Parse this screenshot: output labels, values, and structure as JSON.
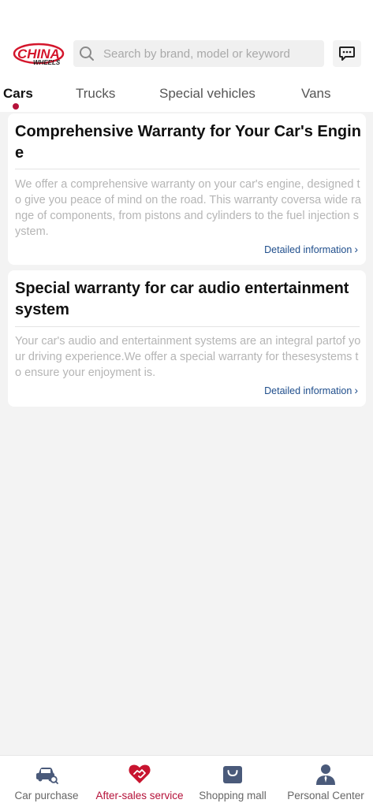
{
  "app": {
    "logo_text": "CHINA",
    "logo_subtext": "WHEELS",
    "brand_color": "#d4162c",
    "accent_color": "#b5123a",
    "link_color": "#1f4e8c"
  },
  "header": {
    "search_placeholder": "Search by brand, model or keyword",
    "search_icon": "search-icon",
    "message_icon": "chat-bubble-icon"
  },
  "tabs": [
    {
      "label": "Cars",
      "active": true
    },
    {
      "label": "Trucks",
      "active": false
    },
    {
      "label": "Special vehicles",
      "active": false
    },
    {
      "label": "Vans",
      "active": false
    }
  ],
  "cards": [
    {
      "title": "Comprehensive Warranty for Your Car's Engine",
      "description": "We offer a comprehensive warranty on your car's engine, designed to give you peace of mind on the road. This warranty coversa wide range of components, from pistons and cylinders to the fuel injection system.",
      "link": "Detailed information"
    },
    {
      "title": "Special warranty for car audio entertainment system",
      "description": "Your car's audio and entertainment systems are an integral partof your driving experience.We offer a special warranty for thesesystems to ensure your enjoyment is.",
      "link": "Detailed information"
    }
  ],
  "bottom_nav": [
    {
      "label": "Car purchase",
      "icon": "car-search-icon",
      "active": false
    },
    {
      "label": "After-sales service",
      "icon": "handshake-heart-icon",
      "active": true
    },
    {
      "label": "Shopping mall",
      "icon": "shopping-bag-icon",
      "active": false
    },
    {
      "label": "Personal Center",
      "icon": "person-icon",
      "active": false
    }
  ]
}
